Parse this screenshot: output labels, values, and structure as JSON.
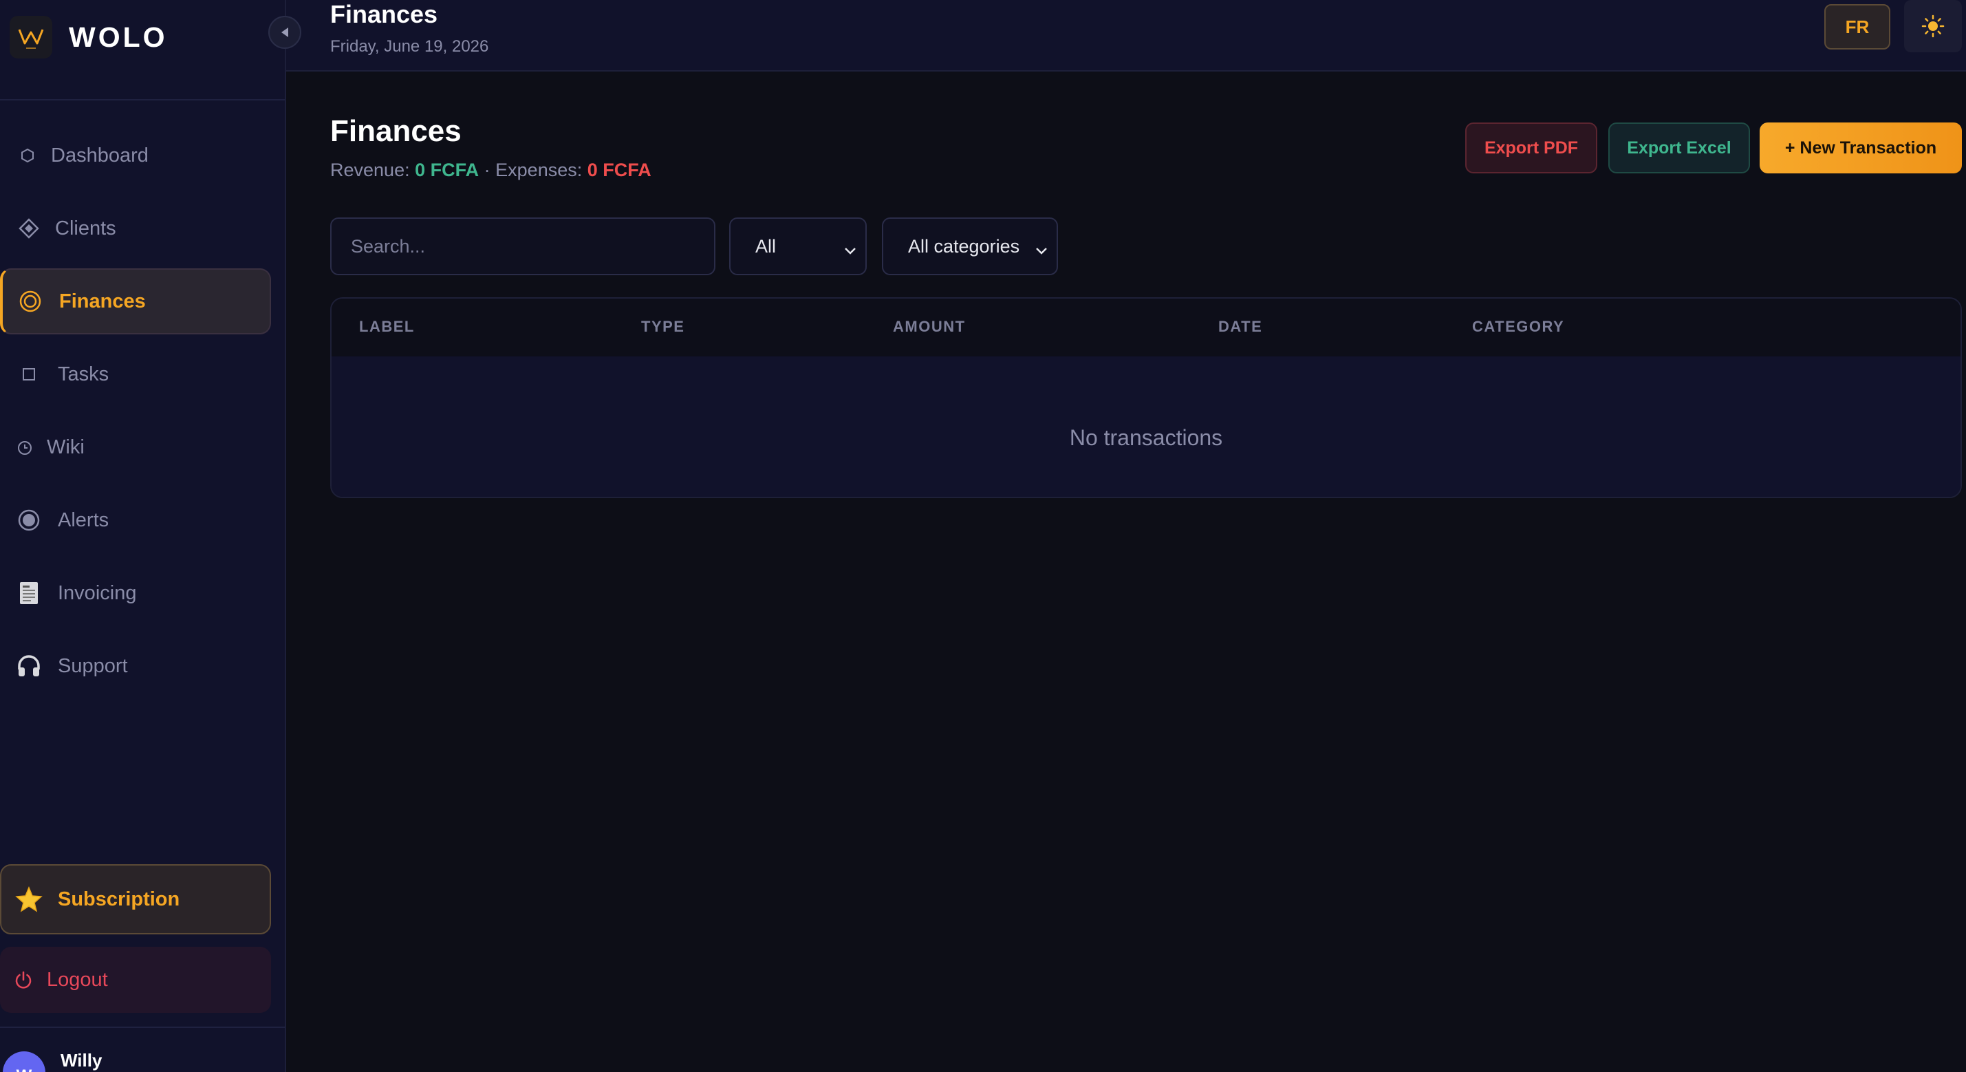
{
  "brand": {
    "name": "WOLO"
  },
  "sidebar": {
    "items": [
      {
        "label": "Dashboard",
        "icon": "hexagon-icon"
      },
      {
        "label": "Clients",
        "icon": "diamond-icon"
      },
      {
        "label": "Finances",
        "icon": "target-icon",
        "active": true
      },
      {
        "label": "Tasks",
        "icon": "square-icon"
      },
      {
        "label": "Wiki",
        "icon": "clock-icon"
      },
      {
        "label": "Alerts",
        "icon": "radio-icon"
      },
      {
        "label": "Invoicing",
        "icon": "receipt-icon"
      },
      {
        "label": "Support",
        "icon": "headphones-icon"
      }
    ],
    "subscription_label": "Subscription",
    "logout_label": "Logout",
    "user": {
      "initial": "W",
      "name": "Willy"
    }
  },
  "header": {
    "title": "Finances",
    "date": "Friday, June 19, 2026",
    "lang": "FR"
  },
  "main": {
    "title": "Finances",
    "revenue_label": "Revenue:",
    "revenue_value": "0 FCFA",
    "separator": "·",
    "expenses_label": "Expenses:",
    "expenses_value": "0 FCFA",
    "buttons": {
      "export_pdf": "Export PDF",
      "export_excel": "Export Excel",
      "new_transaction": "+ New Transaction"
    },
    "search_placeholder": "Search...",
    "type_filter": "All",
    "category_filter": "All categories",
    "table": {
      "columns": [
        "LABEL",
        "TYPE",
        "AMOUNT",
        "DATE",
        "CATEGORY"
      ],
      "empty_text": "No transactions"
    }
  },
  "colors": {
    "accent": "#f5a623",
    "revenue": "#3fb68e",
    "expense": "#ef4d4d",
    "sidebar_bg": "#11122b",
    "page_bg": "#0d0e17"
  }
}
